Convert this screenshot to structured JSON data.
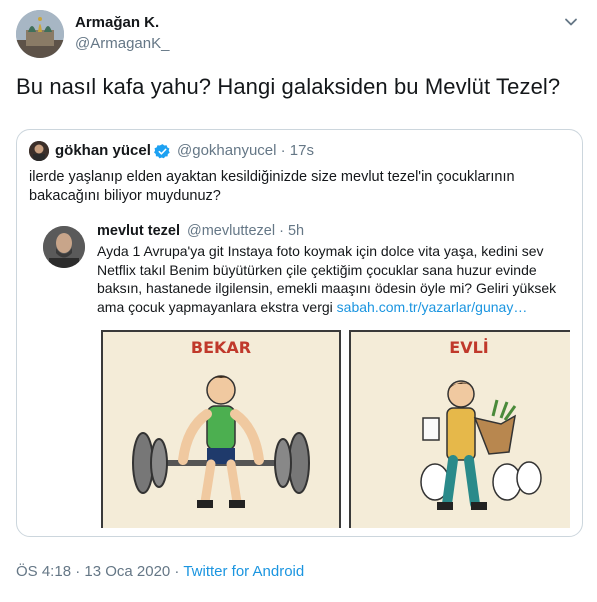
{
  "author": {
    "name": "Armağan K.",
    "handle": "@ArmaganK_"
  },
  "tweet_text": "Bu nasıl kafa yahu? Hangi galaksiden bu Mevlüt Tezel?",
  "quoted": {
    "name": "gökhan yücel",
    "handle_time": "@gokhanyucel · 17s",
    "text": "ilerde yaşlanıp elden ayaktan kesildiğinizde size mevlut tezel'in çocuklarının bakacağını biliyor muydunuz?",
    "screenshot": {
      "name": "mevlut tezel",
      "handle_time": "@mevluttezel · 5h",
      "text": "Ayda 1 Avrupa'ya git Instaya foto koymak için dolce vita yaşa, kedini sev Netflix takıl Benim büyütürken çile çektiğim çocuklar sana huzur evinde baksın, hastanede ilgilensin, emekli maaşını ödesin öyle mi? Geliri yüksek ama çocuk yapmayanlara ekstra vergi",
      "link": "sabah.com.tr/yazarlar/gunay…",
      "left_label": "BEKAR",
      "right_label": "EVLİ"
    }
  },
  "footer": {
    "time_date": "ÖS 4:18 · 13 Oca 2020 · ",
    "source": "Twitter for Android"
  }
}
